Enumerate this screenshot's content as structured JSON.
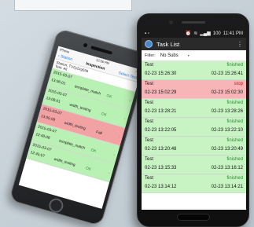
{
  "iphone": {
    "status": {
      "left": "iPhone",
      "center": "12:56 PM"
    },
    "nav": {
      "back_label": "Station",
      "title": "Inspection",
      "action_label": "Select Test"
    },
    "filter_line1": "Station: TVZyZxg556",
    "filter_line2": "Test: All",
    "rows": [
      {
        "date": "2015-03-07",
        "time": "13:06:01",
        "name": "template_match",
        "result": "OK",
        "state": "ok"
      },
      {
        "date": "2015-03-07",
        "time": "13:08:01",
        "name": "width_testing",
        "result": "OK",
        "state": "ok"
      },
      {
        "date": "2015-03-07",
        "time": "13:05:09",
        "name": "width_testing",
        "result": "Fail",
        "state": "fail"
      },
      {
        "date": "2015-03-07",
        "time": "12:49:08",
        "name": "template_match",
        "result": "OK",
        "state": "ok"
      },
      {
        "date": "2015-03-07",
        "time": "12:45:57",
        "name": "width_testing",
        "result": "OK",
        "state": "ok"
      }
    ]
  },
  "android": {
    "status": {
      "time": "11:41 PM",
      "battery": "100"
    },
    "app_title": "Task List",
    "filter_label": "Filter:",
    "filter_value": "No Subs",
    "rows": [
      {
        "task": "Test",
        "status": "finished",
        "start": "02-23 15:26:30",
        "end": "02-23 15:26:41",
        "state": "ok"
      },
      {
        "task": "Test",
        "status": "stop",
        "start": "02-23 15:02:29",
        "end": "02-23 15:02:30",
        "state": "fail"
      },
      {
        "task": "Test",
        "status": "finished",
        "start": "02-23 13:28:21",
        "end": "02-23 13:28:26",
        "state": "ok"
      },
      {
        "task": "Test",
        "status": "finished",
        "start": "02-23 13:22:05",
        "end": "02-23 13:22:10",
        "state": "ok"
      },
      {
        "task": "Test",
        "status": "finished",
        "start": "02-23 13:20:48",
        "end": "02-23 13:20:49",
        "state": "ok"
      },
      {
        "task": "Test",
        "status": "finished",
        "start": "02-23 13:15:33",
        "end": "02-23 13:16:12",
        "state": "ok"
      },
      {
        "task": "Test",
        "status": "finished",
        "start": "02-23 13:14:12",
        "end": "02-23 13:14:21",
        "state": "ok"
      }
    ]
  }
}
